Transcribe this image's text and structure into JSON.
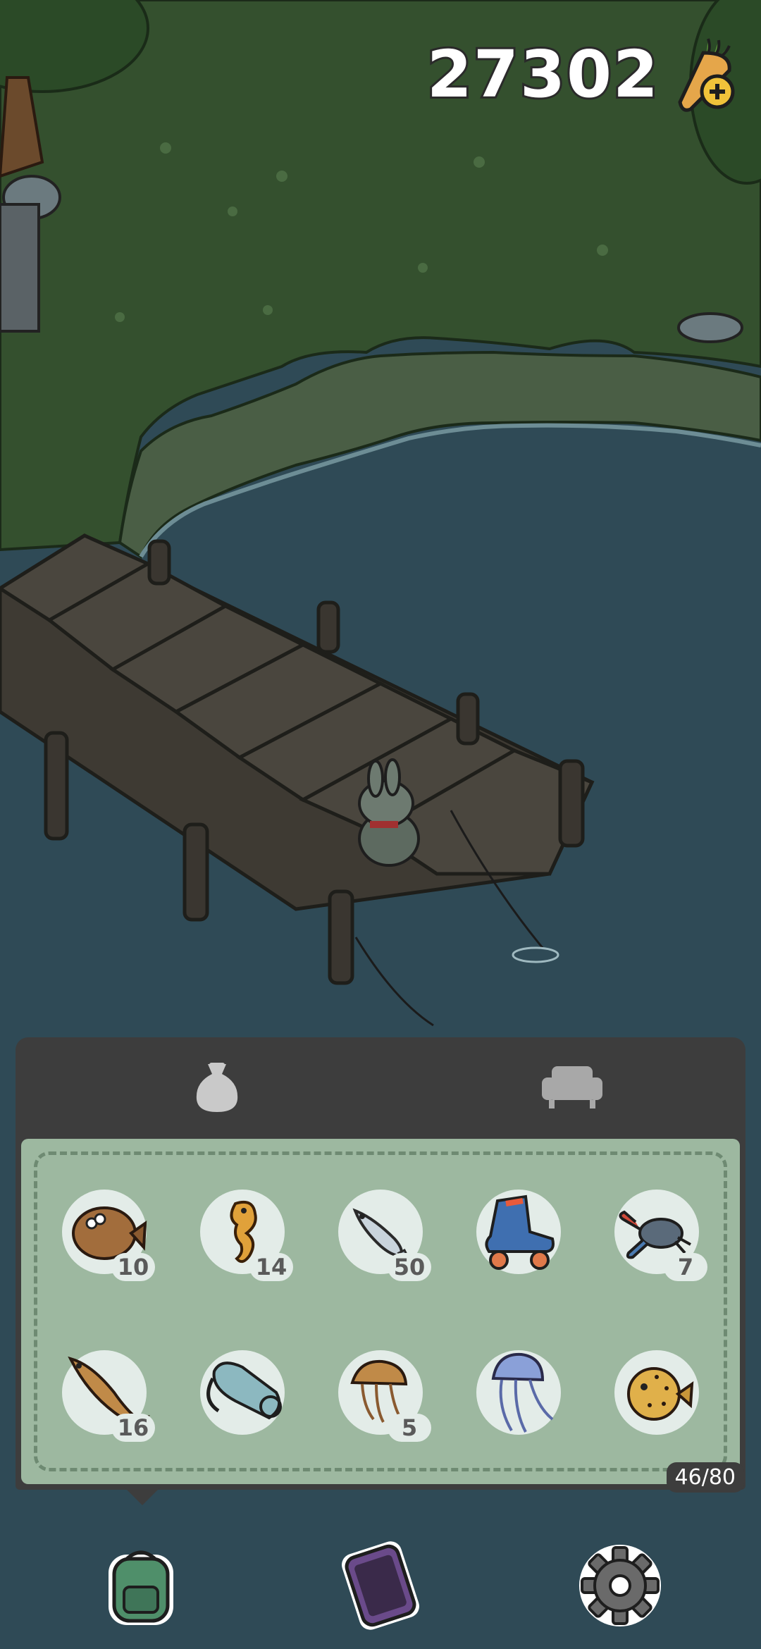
{
  "hud": {
    "carrot_count": "27302",
    "add_currency_icon": "carrot-plus-icon"
  },
  "inventory": {
    "tabs": [
      {
        "name": "bag",
        "icon": "sack-icon",
        "active": true
      },
      {
        "name": "furniture",
        "icon": "sofa-icon",
        "active": false
      }
    ],
    "items": [
      {
        "icon": "flatfish-icon",
        "count": "10"
      },
      {
        "icon": "seahorse-icon",
        "count": "14"
      },
      {
        "icon": "small-fish-icon",
        "count": "50"
      },
      {
        "icon": "roller-skate-icon",
        "count": ""
      },
      {
        "icon": "crab-icon",
        "count": "7"
      },
      {
        "icon": "cod-fish-icon",
        "count": "16"
      },
      {
        "icon": "rolled-mat-icon",
        "count": ""
      },
      {
        "icon": "lion-mane-jellyfish-icon",
        "count": "5"
      },
      {
        "icon": "jellyfish-icon",
        "count": ""
      },
      {
        "icon": "pufferfish-icon",
        "count": ""
      }
    ],
    "capacity": "46/80"
  },
  "nav": [
    {
      "name": "backpack",
      "icon": "backpack-icon"
    },
    {
      "name": "phone",
      "icon": "phone-icon"
    },
    {
      "name": "settings",
      "icon": "gear-icon"
    }
  ],
  "colors": {
    "grass": "#34502e",
    "water": "#2f4a56",
    "panel": "#3d3d3d",
    "grid": "#9db8a0"
  }
}
